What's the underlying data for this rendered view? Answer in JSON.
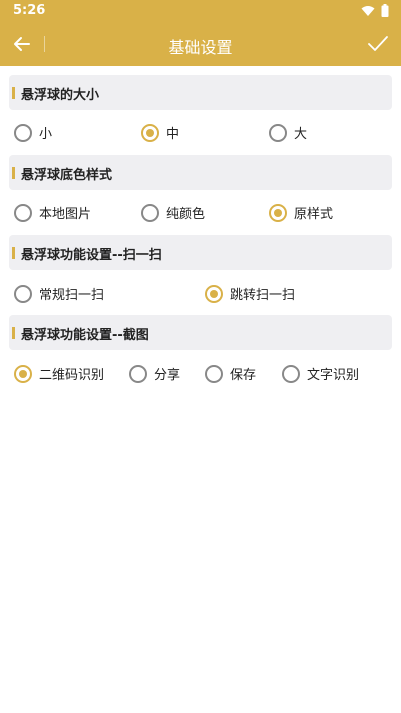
{
  "status": {
    "time": "5:26"
  },
  "appbar": {
    "title": "基础设置"
  },
  "sections": [
    {
      "title": "悬浮球的大小",
      "options": [
        {
          "label": "小",
          "selected": false
        },
        {
          "label": "中",
          "selected": true
        },
        {
          "label": "大",
          "selected": false
        }
      ]
    },
    {
      "title": "悬浮球底色样式",
      "options": [
        {
          "label": "本地图片",
          "selected": false
        },
        {
          "label": "纯颜色",
          "selected": false
        },
        {
          "label": "原样式",
          "selected": true
        }
      ]
    },
    {
      "title": "悬浮球功能设置--扫一扫",
      "options": [
        {
          "label": "常规扫一扫",
          "selected": false
        },
        {
          "label": "跳转扫一扫",
          "selected": true
        }
      ]
    },
    {
      "title": "悬浮球功能设置--截图",
      "options": [
        {
          "label": "二维码识别",
          "selected": true
        },
        {
          "label": "分享",
          "selected": false
        },
        {
          "label": "保存",
          "selected": false
        },
        {
          "label": "文字识别",
          "selected": false
        }
      ]
    }
  ],
  "colors": {
    "accent": "#d9b148",
    "section_bg": "#efeff2"
  },
  "icons": {
    "back": "arrow-left-icon",
    "confirm": "check-icon",
    "wifi": "wifi-icon",
    "battery": "battery-icon"
  }
}
